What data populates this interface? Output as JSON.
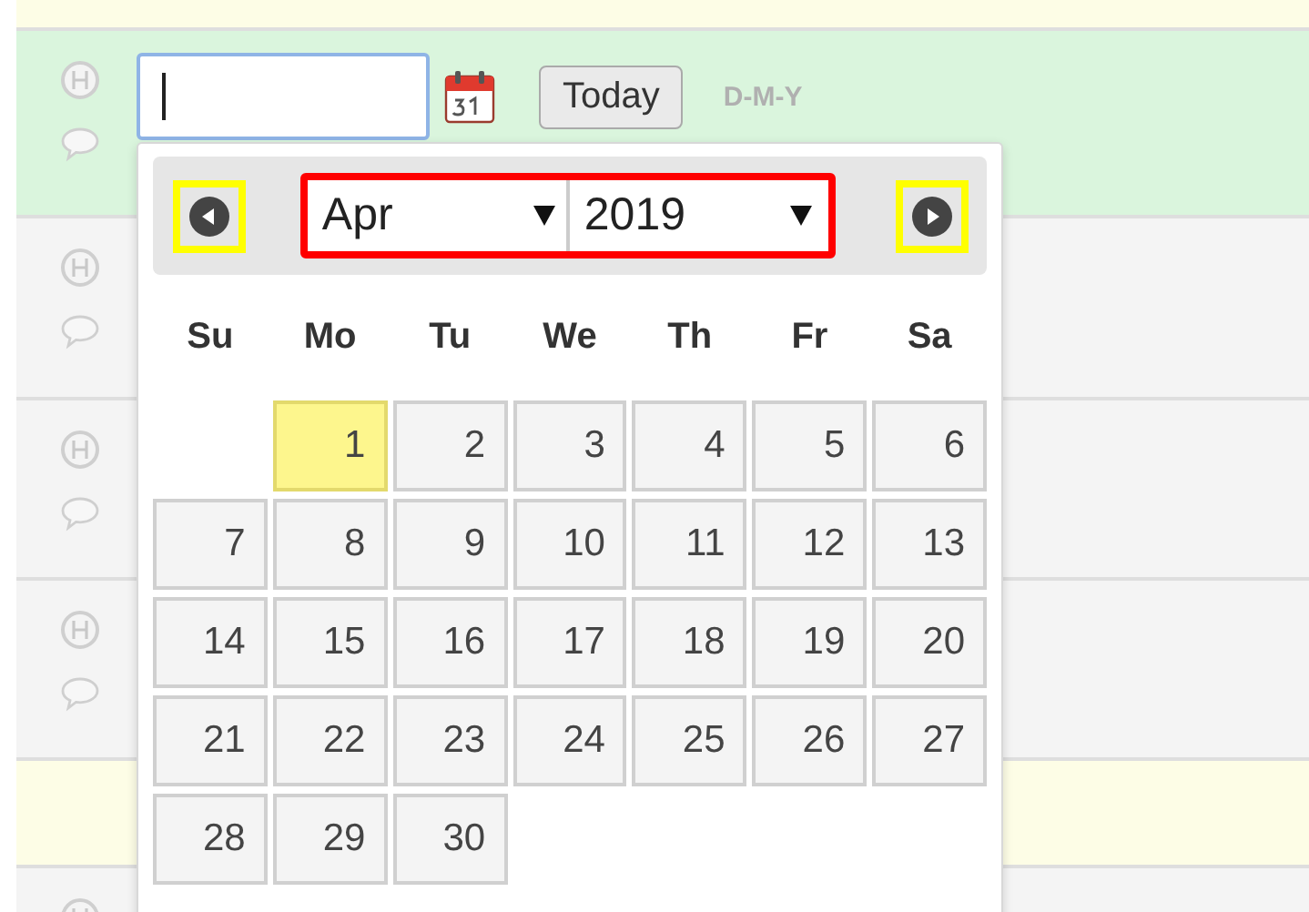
{
  "rows": [
    {
      "kind": "note"
    },
    {
      "kind": "current"
    },
    {
      "kind": "normal"
    },
    {
      "kind": "normal"
    },
    {
      "kind": "normal"
    },
    {
      "kind": "note"
    },
    {
      "kind": "normal"
    }
  ],
  "date_input": {
    "focused": true
  },
  "today_button": "Today",
  "format_hint": "D-M-Y",
  "datepicker": {
    "month": "Apr",
    "year": "2019",
    "weekdays": [
      "Su",
      "Mo",
      "Tu",
      "We",
      "Th",
      "Fr",
      "Sa"
    ],
    "weeks": [
      [
        {
          "kind": "blank"
        },
        {
          "kind": "day",
          "label": "1",
          "today": true
        },
        {
          "label": "2",
          "today": false
        },
        {
          "label": "3",
          "today": false
        },
        {
          "label": "4",
          "today": false
        },
        {
          "label": "5",
          "today": false
        },
        {
          "label": "6",
          "today": false
        }
      ],
      [
        {
          "label": "7",
          "today": false
        },
        {
          "label": "8",
          "today": false
        },
        {
          "label": "9",
          "today": false
        },
        {
          "label": "10",
          "today": false
        },
        {
          "label": "11",
          "today": false
        },
        {
          "label": "12",
          "today": false
        },
        {
          "label": "13",
          "today": false
        }
      ],
      [
        {
          "label": "14",
          "today": false
        },
        {
          "label": "15",
          "today": false
        },
        {
          "label": "16",
          "today": false
        },
        {
          "label": "17",
          "today": false
        },
        {
          "label": "18",
          "today": false
        },
        {
          "label": "19",
          "today": false
        },
        {
          "label": "20",
          "today": false
        }
      ],
      [
        {
          "label": "21",
          "today": false
        },
        {
          "label": "22",
          "today": false
        },
        {
          "label": "23",
          "today": false
        },
        {
          "label": "24",
          "today": false
        },
        {
          "label": "25",
          "today": false
        },
        {
          "label": "26",
          "today": false
        },
        {
          "label": "27",
          "today": false
        }
      ],
      [
        {
          "label": "28",
          "today": false
        },
        {
          "label": "29",
          "today": false
        },
        {
          "label": "30",
          "today": false
        }
      ]
    ]
  }
}
